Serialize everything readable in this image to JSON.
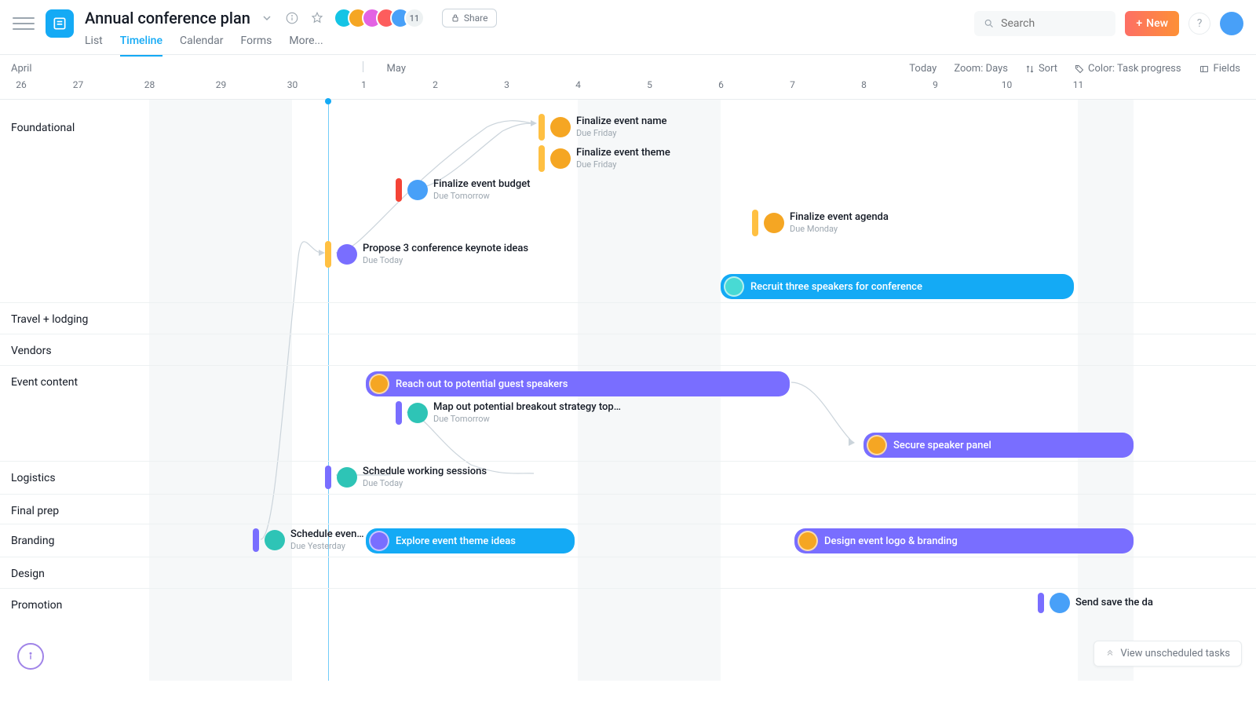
{
  "project": {
    "title": "Annual conference plan"
  },
  "header": {
    "share_label": "Share",
    "new_label": "New",
    "help_label": "?",
    "search_placeholder": "Search",
    "member_overflow": "11"
  },
  "tabs": {
    "list": "List",
    "timeline": "Timeline",
    "calendar": "Calendar",
    "forms": "Forms",
    "more": "More..."
  },
  "months": {
    "april": "April",
    "may": "May"
  },
  "days": [
    "26",
    "27",
    "28",
    "29",
    "30",
    "1",
    "2",
    "3",
    "4",
    "5",
    "6",
    "7",
    "8",
    "9",
    "10",
    "11"
  ],
  "toolbar": {
    "today": "Today",
    "zoom": "Zoom: Days",
    "sort": "Sort",
    "color": "Color: Task progress",
    "fields": "Fields",
    "view_unscheduled": "View unscheduled tasks"
  },
  "sections": {
    "foundational": "Foundational",
    "travel": "Travel + lodging",
    "vendors": "Vendors",
    "event_content": "Event content",
    "logistics": "Logistics",
    "final_prep": "Final prep",
    "branding": "Branding",
    "design": "Design",
    "promotion": "Promotion"
  },
  "tasks": {
    "t1": {
      "title": "Finalize event name",
      "sub": "Due Friday"
    },
    "t2": {
      "title": "Finalize event theme",
      "sub": "Due Friday"
    },
    "t3": {
      "title": "Finalize event budget",
      "sub": "Due Tomorrow"
    },
    "t4": {
      "title": "Finalize event agenda",
      "sub": "Due Monday"
    },
    "t5": {
      "title": "Propose 3 conference keynote ideas",
      "sub": "Due Today"
    },
    "t6": {
      "title": "Recruit three speakers for conference"
    },
    "t7": {
      "title": "Reach out to potential guest speakers"
    },
    "t8": {
      "title": "Map out potential breakout strategy top…",
      "sub": "Due Tomorrow"
    },
    "t9": {
      "title": "Secure speaker panel"
    },
    "t10": {
      "title": "Schedule working sessions",
      "sub": "Due Today"
    },
    "t11": {
      "title": "Schedule event …",
      "sub": "Due Yesterday"
    },
    "t12": {
      "title": "Explore event theme ideas"
    },
    "t13": {
      "title": "Design event logo & branding"
    },
    "t14": {
      "title": "Send save the da"
    }
  },
  "colors": {
    "yellow": "#ffc042",
    "red": "#f44336",
    "purple": "#796eff",
    "blue": "#14aaf5"
  }
}
